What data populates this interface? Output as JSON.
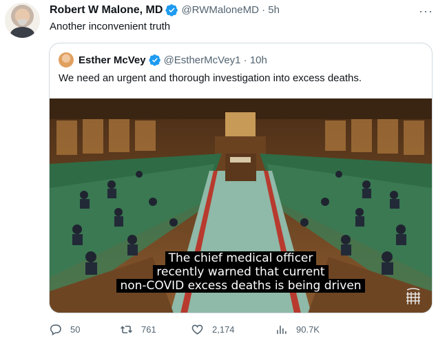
{
  "tweet": {
    "author_name": "Robert W Malone, MD",
    "author_handle": "@RWMaloneMD · 5h",
    "text": "Another inconvenient truth",
    "more_glyph": "···"
  },
  "quoted": {
    "author_name": "Esther McVey",
    "author_handle": "@EstherMcVey1 · 10h",
    "text": "We need an urgent and thorough investigation into excess deaths.",
    "caption_lines": [
      "The chief medical officer",
      "recently warned that current",
      "non-COVID excess deaths is being driven"
    ]
  },
  "actions": {
    "replies": "50",
    "retweets": "761",
    "likes": "2,174",
    "views": "90.7K"
  },
  "icons": [
    "verified-badge-icon",
    "more-icon",
    "reply-icon",
    "retweet-icon",
    "like-icon",
    "views-icon",
    "portcullis-logo-icon"
  ],
  "colors": {
    "verified": "#1d9bf0",
    "text": "#0f1419",
    "secondary": "#536471",
    "border": "#cfd9de"
  }
}
